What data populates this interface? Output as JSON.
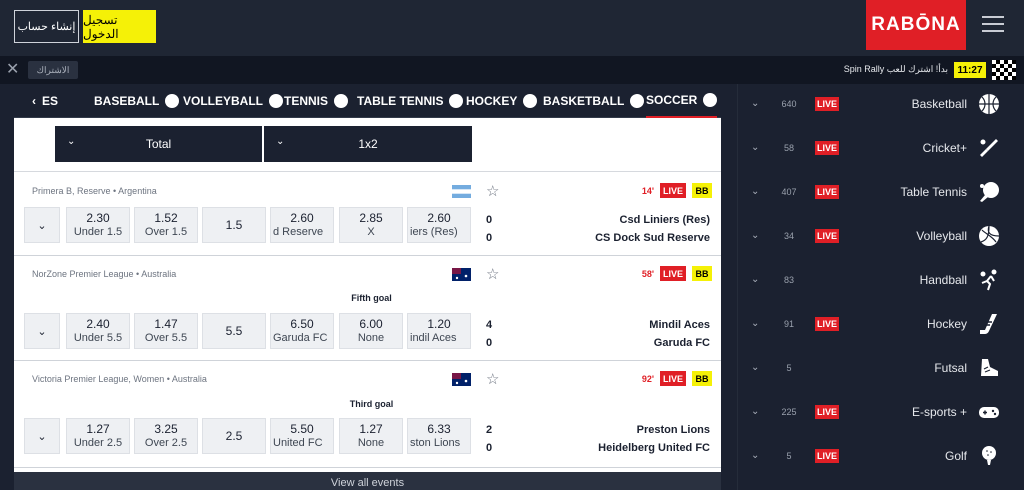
{
  "header": {
    "register_label": "إنشاء حساب",
    "login_label": "تسجيل الدخول",
    "logo_text": "RABŌNA"
  },
  "ticker": {
    "subscribe_label": "الاشتراك",
    "text": "Spin Rally بدأ! اشترك للعب",
    "time": "11:27"
  },
  "sports_nav": [
    {
      "label": "ES",
      "icon": "chevron-left-icon"
    },
    {
      "label": "BASEBALL",
      "icon": "baseball-icon"
    },
    {
      "label": "VOLLEYBALL",
      "icon": "volleyball-icon"
    },
    {
      "label": "TENNIS",
      "icon": "tennis-icon"
    },
    {
      "label": "TABLE TENNIS",
      "icon": "table-tennis-icon"
    },
    {
      "label": "HOCKEY",
      "icon": "hockey-icon"
    },
    {
      "label": "BASKETBALL",
      "icon": "basketball-icon"
    },
    {
      "label": "SOCCER",
      "icon": "soccer-icon",
      "active": true
    }
  ],
  "filters": {
    "market_1": "Total",
    "market_2": "1x2"
  },
  "events": [
    {
      "league": "Primera B, Reserve • Argentina",
      "flag": "argentina-flag",
      "minute": "14'",
      "live": "LIVE",
      "bb": "BB",
      "goal_label": "",
      "odds": [
        {
          "value": "2.30",
          "label": "Under 1.5"
        },
        {
          "value": "1.52",
          "label": "Over 1.5"
        },
        {
          "value": "1.5",
          "label": ""
        },
        {
          "value": "2.60",
          "label": "d Reserve"
        },
        {
          "value": "2.85",
          "label": "X"
        },
        {
          "value": "2.60",
          "label": "iers (Res)"
        }
      ],
      "score_home": "0",
      "score_away": "0",
      "team_home": "Csd Liniers (Res)",
      "team_away": "CS Dock Sud Reserve"
    },
    {
      "league": "NorZone Premier League • Australia",
      "flag": "australia-flag",
      "minute": "58'",
      "live": "LIVE",
      "bb": "BB",
      "goal_label": "Fifth goal",
      "odds": [
        {
          "value": "2.40",
          "label": "Under 5.5"
        },
        {
          "value": "1.47",
          "label": "Over 5.5"
        },
        {
          "value": "5.5",
          "label": ""
        },
        {
          "value": "6.50",
          "label": "Garuda FC"
        },
        {
          "value": "6.00",
          "label": "None"
        },
        {
          "value": "1.20",
          "label": "indil Aces"
        }
      ],
      "score_home": "4",
      "score_away": "0",
      "team_home": "Mindil Aces",
      "team_away": "Garuda FC"
    },
    {
      "league": "Victoria Premier League, Women • Australia",
      "flag": "australia-flag",
      "minute": "92'",
      "live": "LIVE",
      "bb": "BB",
      "goal_label": "Third goal",
      "odds": [
        {
          "value": "1.27",
          "label": "Under 2.5"
        },
        {
          "value": "3.25",
          "label": "Over 2.5"
        },
        {
          "value": "2.5",
          "label": ""
        },
        {
          "value": "5.50",
          "label": "United FC"
        },
        {
          "value": "1.27",
          "label": "None"
        },
        {
          "value": "6.33",
          "label": "ston Lions"
        }
      ],
      "score_home": "2",
      "score_away": "0",
      "team_home": "Preston Lions",
      "team_away": "Heidelberg United FC"
    }
  ],
  "view_all_label": "View all events",
  "sidebar": [
    {
      "count": "640",
      "live": "LIVE",
      "name": "Basketball",
      "icon": "basketball-icon"
    },
    {
      "count": "58",
      "live": "LIVE",
      "name": "Cricket+",
      "icon": "cricket-icon"
    },
    {
      "count": "407",
      "live": "LIVE",
      "name": "Table Tennis",
      "icon": "table-tennis-icon"
    },
    {
      "count": "34",
      "live": "LIVE",
      "name": "Volleyball",
      "icon": "volleyball-icon"
    },
    {
      "count": "83",
      "live": "",
      "name": "Handball",
      "icon": "handball-icon"
    },
    {
      "count": "91",
      "live": "LIVE",
      "name": "Hockey",
      "icon": "hockey-icon"
    },
    {
      "count": "5",
      "live": "",
      "name": "Futsal",
      "icon": "futsal-icon"
    },
    {
      "count": "225",
      "live": "LIVE",
      "name": "E-sports +",
      "icon": "gamepad-icon"
    },
    {
      "count": "5",
      "live": "LIVE",
      "name": "Golf",
      "icon": "golf-icon"
    }
  ],
  "colors": {
    "brand_red": "#e01f26",
    "accent_yellow": "#f5f107",
    "dark_bg": "#1b2130"
  }
}
